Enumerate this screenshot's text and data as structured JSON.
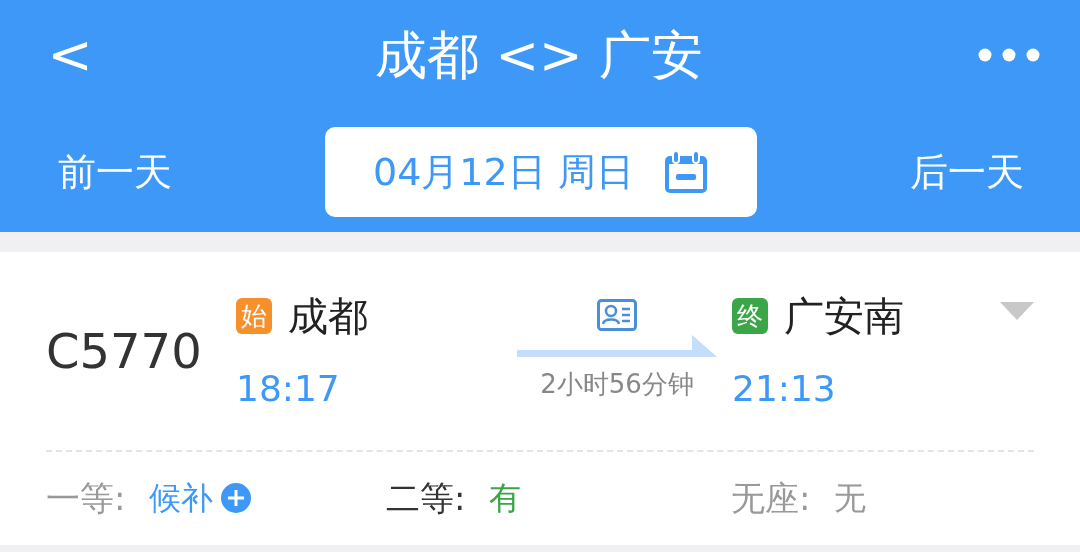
{
  "header": {
    "back": "<",
    "title": "成都 <> 广安",
    "prev_day": "前一天",
    "date": "04月12日 周日",
    "next_day": "后一天"
  },
  "train": {
    "number": "C5770",
    "expanded": false,
    "departure": {
      "badge": "始",
      "color": "#f7902a",
      "station": "成都",
      "time": "18:17"
    },
    "duration": "2小时56分钟",
    "arrival": {
      "badge": "终",
      "color": "#3aa647",
      "station": "广安南",
      "time": "21:13"
    },
    "seats": [
      {
        "label": "一等:",
        "value": "候补",
        "kind": "waitlist"
      },
      {
        "label": "二等:",
        "value": "有",
        "kind": "available"
      },
      {
        "label": "无座:",
        "value": "无",
        "kind": "none"
      }
    ]
  }
}
